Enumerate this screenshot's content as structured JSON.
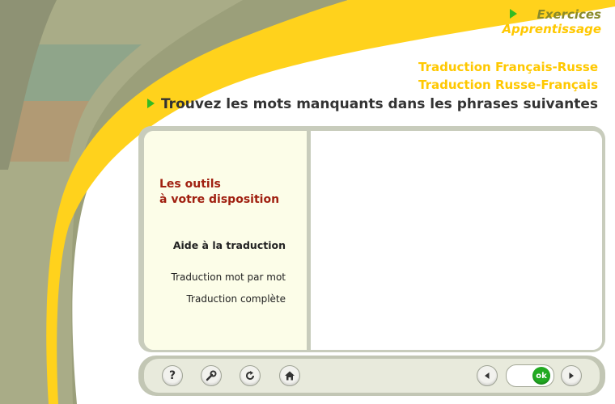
{
  "nav": {
    "exercises_label": "Exercices",
    "learning_label": "Apprentissage"
  },
  "modes": {
    "fr_ru": "Traduction Français-Russe",
    "ru_fr": "Traduction Russe-Français"
  },
  "instruction": "Trouvez les mots manquants dans les phrases suivantes",
  "sidebar": {
    "heading_line1": "Les outils",
    "heading_line2": "à votre disposition",
    "section_title": "Aide à la traduction",
    "items": [
      "Traduction mot par mot",
      "Traduction complète"
    ]
  },
  "toolbar": {
    "ok_label": "ok",
    "icons": [
      "help-icon",
      "tools-icon",
      "refresh-icon",
      "home-icon",
      "previous-icon",
      "next-icon"
    ]
  },
  "colors": {
    "accent_yellow": "#ffc800",
    "heading_red": "#a02010",
    "arrow_green": "#33bb22",
    "exercise_olive": "#8a8a2a",
    "ok_green": "#22aa22"
  }
}
